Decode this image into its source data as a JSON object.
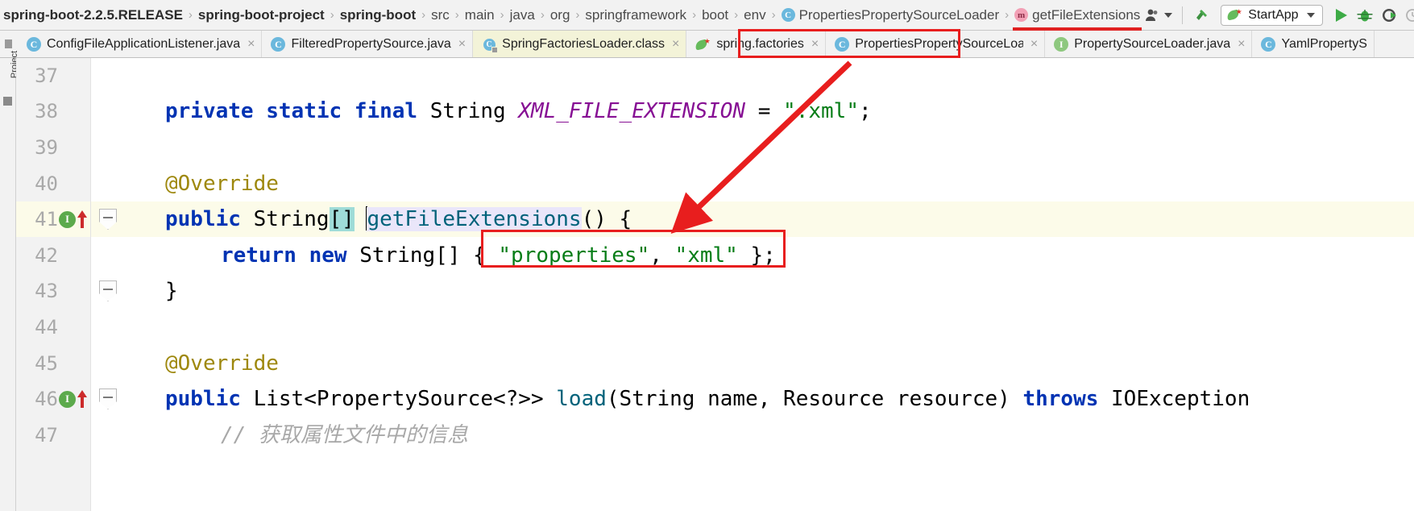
{
  "navbar": {
    "breadcrumb": [
      {
        "label": "spring-boot-2.2.5.RELEASE",
        "style": "bold",
        "icon": ""
      },
      {
        "label": "spring-boot-project",
        "style": "bold",
        "icon": ""
      },
      {
        "label": "spring-boot",
        "style": "bold",
        "icon": ""
      },
      {
        "label": "src",
        "style": "dim",
        "icon": ""
      },
      {
        "label": "main",
        "style": "dim",
        "icon": ""
      },
      {
        "label": "java",
        "style": "dim",
        "icon": ""
      },
      {
        "label": "org",
        "style": "dim",
        "icon": ""
      },
      {
        "label": "springframework",
        "style": "dim",
        "icon": ""
      },
      {
        "label": "boot",
        "style": "dim",
        "icon": ""
      },
      {
        "label": "env",
        "style": "dim",
        "icon": ""
      },
      {
        "label": "PropertiesPropertySourceLoader",
        "style": "dim",
        "icon": "class-badge-icon",
        "badge": "C"
      },
      {
        "label": "getFileExtensions",
        "style": "dim",
        "icon": "method-badge-icon",
        "badge": "m"
      }
    ],
    "separator": "›",
    "toolbar": {
      "avatar_label": "person-icon",
      "hammer_label": "build-icon",
      "run_config": "StartApp",
      "run_label": "run-icon",
      "debug_label": "debug-icon",
      "coverage_label": "run-with-coverage-icon",
      "profile_label": "profiler-icon",
      "overflow_label": "more-icon",
      "dropdown_caret": "▾"
    }
  },
  "tabs": [
    {
      "label": "ConfigFileApplicationListener.java",
      "icon": "class-icon",
      "badge": "C",
      "active": false,
      "close": "×"
    },
    {
      "label": "FilteredPropertySource.java",
      "icon": "class-icon",
      "badge": "C",
      "active": false,
      "close": "×"
    },
    {
      "label": "SpringFactoriesLoader.class",
      "icon": "class-file-icon",
      "badge": "C",
      "active": true,
      "close": "×"
    },
    {
      "label": "spring.factories",
      "icon": "spring-leaf-icon",
      "badge": "",
      "active": false,
      "close": "×"
    },
    {
      "label": "PropertiesPropertySourceLoader.java",
      "icon": "class-icon",
      "badge": "C",
      "active": false,
      "close": "×",
      "highlighted": true
    },
    {
      "label": "PropertySourceLoader.java",
      "icon": "interface-icon",
      "badge": "I",
      "active": false,
      "close": "×"
    },
    {
      "label": "YamlPropertyS",
      "icon": "class-icon",
      "badge": "C",
      "active": false,
      "close": ""
    }
  ],
  "left_tool_window": {
    "label": "Project"
  },
  "editor": {
    "lines": [
      {
        "num": "37",
        "highlight": false,
        "indent": 0,
        "tokens": []
      },
      {
        "num": "38",
        "highlight": false,
        "indent": 1,
        "tokens": [
          {
            "t": "private ",
            "c": "kw"
          },
          {
            "t": "static ",
            "c": "kw"
          },
          {
            "t": "final ",
            "c": "kw"
          },
          {
            "t": "String ",
            "c": "plain"
          },
          {
            "t": "XML_FILE_EXTENSION",
            "c": "fld"
          },
          {
            "t": " = ",
            "c": "plain"
          },
          {
            "t": "\".xml\"",
            "c": "str"
          },
          {
            "t": ";",
            "c": "plain"
          }
        ]
      },
      {
        "num": "39",
        "highlight": false,
        "indent": 0,
        "tokens": []
      },
      {
        "num": "40",
        "highlight": false,
        "indent": 1,
        "tokens": [
          {
            "t": "@Override",
            "c": "ann"
          }
        ]
      },
      {
        "num": "41",
        "highlight": true,
        "indent": 1,
        "gutter": "implemented-method-icon",
        "fold": true,
        "tokens": [
          {
            "t": "public ",
            "c": "kw"
          },
          {
            "t": "String",
            "c": "plain"
          },
          {
            "t": "[]",
            "c": "hl-brackets"
          },
          {
            "t": " ",
            "c": "plain"
          },
          {
            "t": "CARET",
            "c": "caret"
          },
          {
            "t": "getFileExtensions",
            "c": "mth hl-name"
          },
          {
            "t": "() {",
            "c": "plain"
          }
        ]
      },
      {
        "num": "42",
        "highlight": false,
        "indent": 2,
        "tokens": [
          {
            "t": "return ",
            "c": "kw"
          },
          {
            "t": "new ",
            "c": "kw"
          },
          {
            "t": "String[] { ",
            "c": "plain"
          },
          {
            "t": "\"properties\"",
            "c": "str"
          },
          {
            "t": ", ",
            "c": "plain"
          },
          {
            "t": "\"xml\"",
            "c": "str"
          },
          {
            "t": " };",
            "c": "plain"
          }
        ]
      },
      {
        "num": "43",
        "highlight": false,
        "indent": 1,
        "fold": true,
        "tokens": [
          {
            "t": "}",
            "c": "plain"
          }
        ]
      },
      {
        "num": "44",
        "highlight": false,
        "indent": 0,
        "tokens": []
      },
      {
        "num": "45",
        "highlight": false,
        "indent": 1,
        "tokens": [
          {
            "t": "@Override",
            "c": "ann"
          }
        ]
      },
      {
        "num": "46",
        "highlight": false,
        "indent": 1,
        "gutter": "implemented-method-icon",
        "fold": true,
        "tokens": [
          {
            "t": "public ",
            "c": "kw"
          },
          {
            "t": "List<PropertySource<?>> ",
            "c": "plain"
          },
          {
            "t": "load",
            "c": "mth"
          },
          {
            "t": "(String name, Resource resource) ",
            "c": "plain"
          },
          {
            "t": "throws ",
            "c": "kw"
          },
          {
            "t": "IOException",
            "c": "plain"
          }
        ]
      },
      {
        "num": "47",
        "highlight": false,
        "indent": 2,
        "tokens": [
          {
            "t": "// 获取属性文件中的信息",
            "c": "cmt"
          }
        ]
      }
    ]
  },
  "annotations": {
    "tab_highlight_color": "#e81e1e",
    "return_box_color": "#e81e1e",
    "arrow_color": "#e81e1e",
    "arrow_name": "red-pointer-arrow"
  }
}
